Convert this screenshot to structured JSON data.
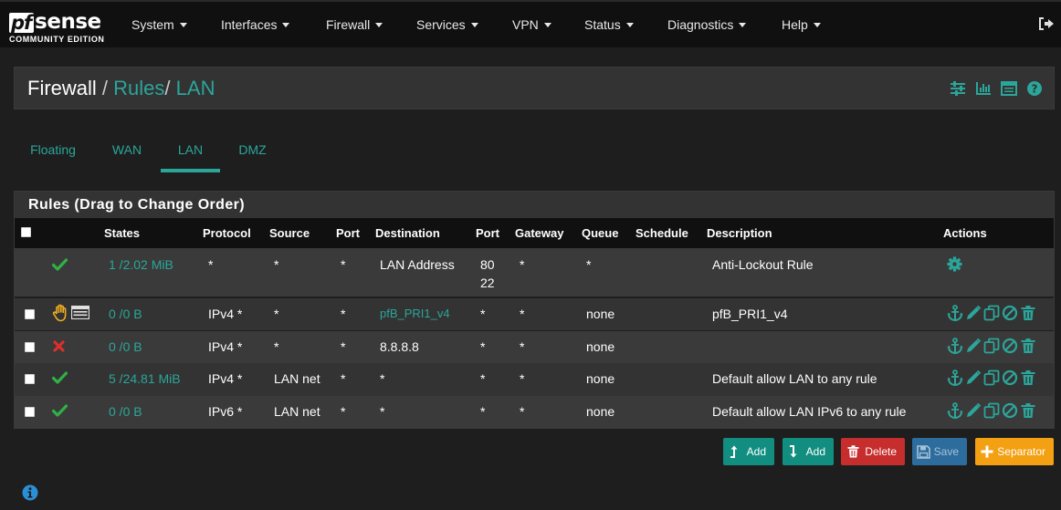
{
  "brand": {
    "pf": "pf",
    "sense": "sense",
    "edition": "COMMUNITY EDITION"
  },
  "nav": {
    "items": [
      "System",
      "Interfaces",
      "Firewall",
      "Services",
      "VPN",
      "Status",
      "Diagnostics",
      "Help"
    ]
  },
  "breadcrumb": {
    "part1": "Firewall",
    "sep": "/",
    "part2": "Rules",
    "part3": "LAN"
  },
  "tabs": [
    "Floating",
    "WAN",
    "LAN",
    "DMZ"
  ],
  "active_tab": "LAN",
  "rules": {
    "title": "Rules (Drag to Change Order)",
    "columns": [
      "States",
      "Protocol",
      "Source",
      "Port",
      "Destination",
      "Port",
      "Gateway",
      "Queue",
      "Schedule",
      "Description",
      "Actions"
    ],
    "rows": [
      {
        "status": "pass",
        "states": "1 /2.02 MiB",
        "protocol": "*",
        "source": "*",
        "sport": "*",
        "destination": "LAN Address",
        "dport": "80",
        "dport2": "22",
        "gateway": "*",
        "queue": "*",
        "schedule": "",
        "description": "Anti-Lockout Rule"
      },
      {
        "status": "hand",
        "states": "0 /0 B",
        "protocol": "IPv4 *",
        "source": "*",
        "sport": "*",
        "destination": "pfB_PRI1_v4",
        "dport": "*",
        "gateway": "*",
        "queue": "none",
        "schedule": "",
        "description": "pfB_PRI1_v4"
      },
      {
        "status": "block",
        "states": "0 /0 B",
        "protocol": "IPv4 *",
        "source": "*",
        "sport": "*",
        "destination": "8.8.8.8",
        "dport": "*",
        "gateway": "*",
        "queue": "none",
        "schedule": "",
        "description": ""
      },
      {
        "status": "pass",
        "states": "5 /24.81 MiB",
        "protocol": "IPv4 *",
        "source": "LAN net",
        "sport": "*",
        "destination": "*",
        "dport": "*",
        "gateway": "*",
        "queue": "none",
        "schedule": "",
        "description": "Default allow LAN to any rule"
      },
      {
        "status": "pass",
        "states": "0 /0 B",
        "protocol": "IPv6 *",
        "source": "LAN net",
        "sport": "*",
        "destination": "*",
        "dport": "*",
        "gateway": "*",
        "queue": "none",
        "schedule": "",
        "description": "Default allow LAN IPv6 to any rule"
      }
    ]
  },
  "buttons": {
    "add_top": "Add",
    "add_bottom": "Add",
    "delete": "Delete",
    "save": "Save",
    "separator": "Separator"
  },
  "colors": {
    "accent": "#2ba69a",
    "pass": "#2fb048",
    "block": "#d9302c",
    "hand": "#f0b020",
    "navbar": "#101010",
    "panel": "#333333"
  },
  "icons": {
    "toolbar": [
      "sliders-icon",
      "bar-chart-icon",
      "table-icon",
      "help-icon"
    ],
    "row_actions": [
      "anchor-icon",
      "pencil-icon",
      "copy-icon",
      "disable-icon",
      "trash-icon"
    ],
    "status": [
      "check-icon",
      "hand-icon",
      "cross-icon"
    ]
  }
}
